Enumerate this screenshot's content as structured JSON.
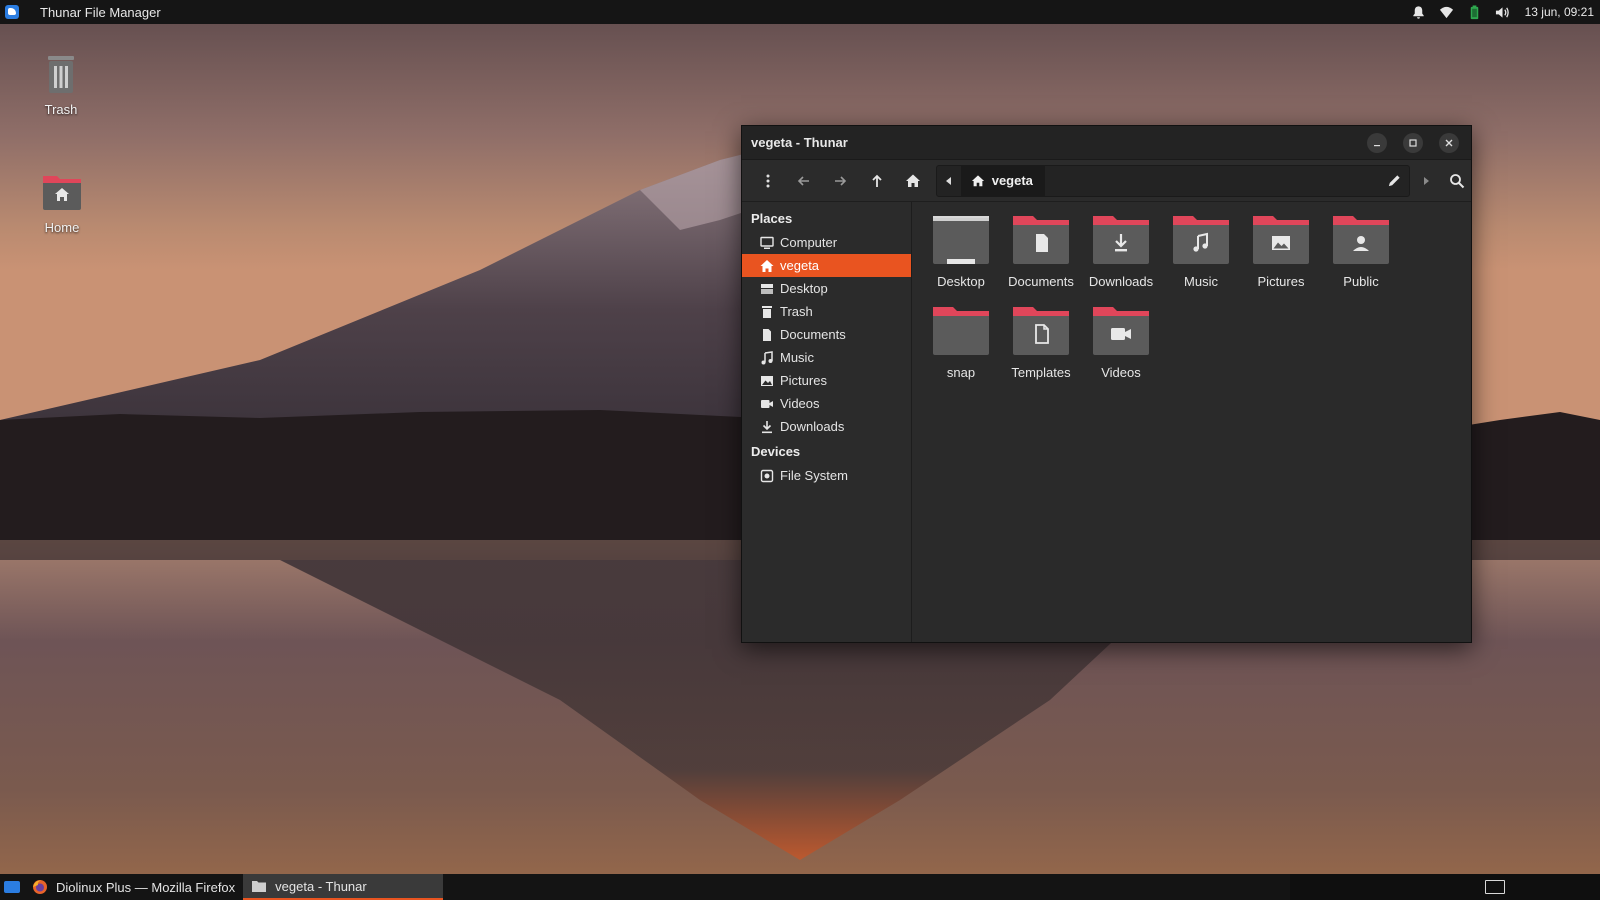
{
  "top_panel": {
    "app_title": "Thunar File Manager",
    "clock": "13 jun, 09:21",
    "tray_icons": [
      "bell-icon",
      "wifi-icon",
      "battery-icon",
      "volume-icon"
    ]
  },
  "desktop": {
    "icons": [
      {
        "label": "Trash",
        "icon": "trash-icon"
      },
      {
        "label": "Home",
        "icon": "home-folder-icon"
      }
    ]
  },
  "window": {
    "title": "vegeta - Thunar",
    "pathbar": {
      "current": "vegeta"
    },
    "sidebar": {
      "places_heading": "Places",
      "places": [
        {
          "label": "Computer",
          "icon": "computer-icon",
          "active": false
        },
        {
          "label": "vegeta",
          "icon": "home-icon",
          "active": true
        },
        {
          "label": "Desktop",
          "icon": "desktop-icon",
          "active": false
        },
        {
          "label": "Trash",
          "icon": "trash-icon",
          "active": false
        },
        {
          "label": "Documents",
          "icon": "document-icon",
          "active": false
        },
        {
          "label": "Music",
          "icon": "music-icon",
          "active": false
        },
        {
          "label": "Pictures",
          "icon": "picture-icon",
          "active": false
        },
        {
          "label": "Videos",
          "icon": "video-icon",
          "active": false
        },
        {
          "label": "Downloads",
          "icon": "download-icon",
          "active": false
        }
      ],
      "devices_heading": "Devices",
      "devices": [
        {
          "label": "File System",
          "icon": "drive-icon"
        }
      ]
    },
    "files": [
      {
        "label": "Desktop",
        "emblem": "desktop",
        "style": "grey"
      },
      {
        "label": "Documents",
        "emblem": "document",
        "style": "red"
      },
      {
        "label": "Downloads",
        "emblem": "download",
        "style": "red"
      },
      {
        "label": "Music",
        "emblem": "music",
        "style": "red"
      },
      {
        "label": "Pictures",
        "emblem": "picture",
        "style": "red"
      },
      {
        "label": "Public",
        "emblem": "person",
        "style": "red"
      },
      {
        "label": "snap",
        "emblem": "none",
        "style": "red"
      },
      {
        "label": "Templates",
        "emblem": "template",
        "style": "red"
      },
      {
        "label": "Videos",
        "emblem": "video",
        "style": "red"
      }
    ]
  },
  "taskbar": {
    "tasks": [
      {
        "label": "Diolinux Plus — Mozilla Firefox",
        "icon": "firefox-icon",
        "active": false
      },
      {
        "label": "vegeta - Thunar",
        "icon": "folder-icon",
        "active": true
      }
    ]
  },
  "colors": {
    "accent": "#e95420",
    "folder_red": "#e0465a",
    "folder_body": "#5b5b5b",
    "panel_bg": "#151515",
    "window_bg": "#2a2a2a"
  }
}
